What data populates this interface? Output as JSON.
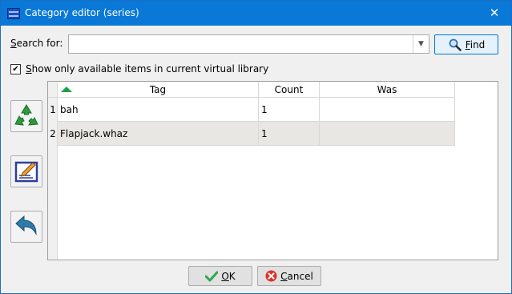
{
  "window": {
    "title": "Category editor (series)",
    "close_glyph": "✕"
  },
  "search": {
    "label_first": "S",
    "label_rest": "earch for:",
    "value": "",
    "placeholder": "",
    "find_label_first": "F",
    "find_label_rest": "ind"
  },
  "filter": {
    "checked": true,
    "check_glyph": "✔",
    "label_first": "S",
    "label_rest": "how only available items in current virtual library"
  },
  "side_buttons": [
    {
      "icon": "recycle-icon"
    },
    {
      "icon": "edit-note-icon"
    },
    {
      "icon": "undo-arrow-icon"
    }
  ],
  "table": {
    "columns": [
      "Tag",
      "Count",
      "Was"
    ],
    "sort_column": "Tag",
    "rows": [
      {
        "num": "1",
        "tag": "bah",
        "count": "1",
        "was": ""
      },
      {
        "num": "2",
        "tag": "Flapjack.whaz",
        "count": "1",
        "was": ""
      }
    ]
  },
  "buttons": {
    "ok_first": "O",
    "ok_rest": "K",
    "cancel_first": "C",
    "cancel_rest": "ancel"
  },
  "colors": {
    "titlebar": "#0a78d7",
    "find_border": "#0078d7",
    "sort_arrow": "#1aa34a",
    "recycle": "#2f9a3b",
    "ok_check": "#2fa84f",
    "cancel_x": "#d9342b"
  }
}
